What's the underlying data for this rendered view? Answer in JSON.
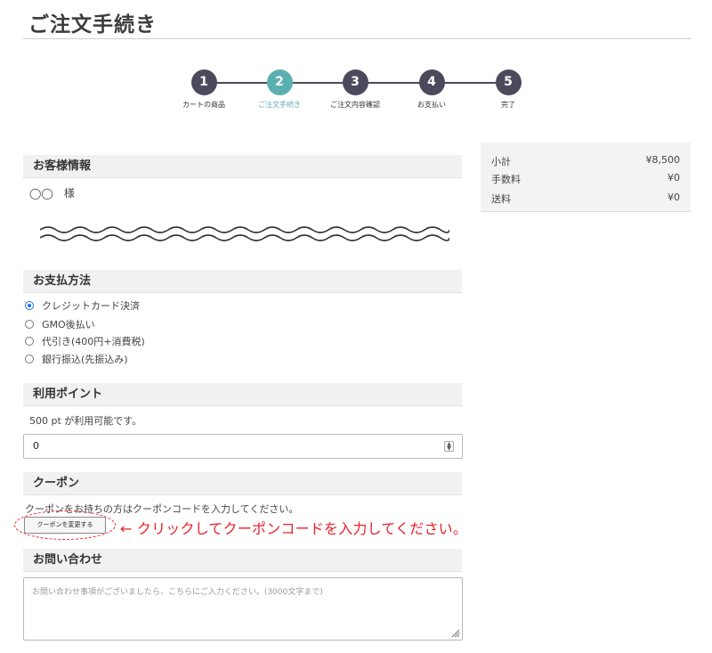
{
  "page_title": "ご注文手続き",
  "steps": [
    {
      "number": "1",
      "label": "カートの商品",
      "active": false
    },
    {
      "number": "2",
      "label": "ご注文手続き",
      "active": true
    },
    {
      "number": "3",
      "label": "ご注文内容確認",
      "active": false
    },
    {
      "number": "4",
      "label": "お支払い",
      "active": false
    },
    {
      "number": "5",
      "label": "完了",
      "active": false
    }
  ],
  "customer": {
    "heading": "お客様情報",
    "name": "◯◯　様"
  },
  "payment": {
    "heading": "お支払方法",
    "options": [
      {
        "label": "クレジットカード決済",
        "selected": true
      },
      {
        "label": "GMO後払い",
        "selected": false
      },
      {
        "label": "代引き(400円+消費税)",
        "selected": false
      },
      {
        "label": "銀行振込(先振込み)",
        "selected": false
      }
    ]
  },
  "points": {
    "heading": "利用ポイント",
    "available_text": "500 pt が利用可能です。",
    "value": "0"
  },
  "coupon": {
    "heading": "クーポン",
    "description": "クーポンをお持ちの方はクーポンコードを入力してください。",
    "button_label": "クーポンを変更する",
    "annotation": "← クリックしてクーポンコードを入力してください。",
    "annotation_color": "#e8202a"
  },
  "inquiry": {
    "heading": "お問い合わせ",
    "placeholder": "お問い合わせ事項がございましたら、こちらにご入力ください。(3000文字まで)"
  },
  "summary": {
    "rows": [
      {
        "label": "小計",
        "value": "¥8,500"
      },
      {
        "label": "手数料",
        "value": "¥0"
      },
      {
        "label": "送料",
        "value": "¥0"
      }
    ]
  },
  "colors": {
    "step_default": "#4b4a5c",
    "step_active": "#5aafb1",
    "radio_checked": "#1a73e8"
  }
}
